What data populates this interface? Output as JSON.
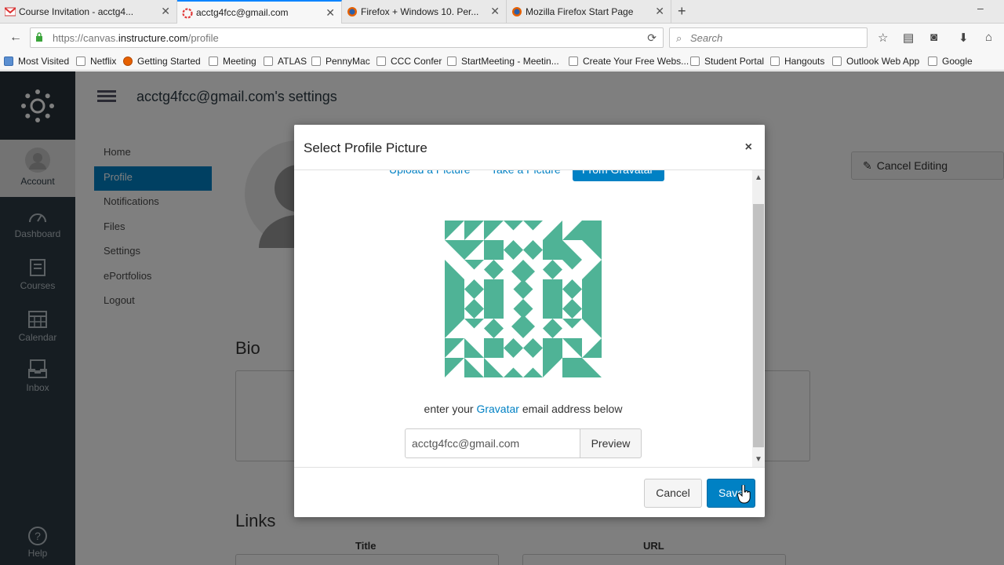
{
  "browser": {
    "tabs": [
      {
        "label": "Course Invitation - acctg4...",
        "icon": "gmail-icon"
      },
      {
        "label": "acctg4fcc@gmail.com",
        "icon": "canvas-icon"
      },
      {
        "label": "Firefox + Windows 10. Per...",
        "icon": "firefox-icon"
      },
      {
        "label": "Mozilla Firefox Start Page",
        "icon": "firefox-icon"
      }
    ],
    "url_prefix": "https://canvas.",
    "url_domain": "instructure.com",
    "url_path": "/profile",
    "search_placeholder": "Search",
    "bookmarks": [
      "Most Visited",
      "Netflix",
      "Getting Started",
      "Meeting",
      "ATLAS",
      "PennyMac",
      "CCC Confer",
      "StartMeeting - Meetin...",
      "Create Your Free Webs...",
      "Student Portal",
      "Hangouts",
      "Outlook Web App",
      "Google"
    ]
  },
  "global_nav": {
    "account": "Account",
    "dashboard": "Dashboard",
    "courses": "Courses",
    "calendar": "Calendar",
    "inbox": "Inbox",
    "help": "Help"
  },
  "header": {
    "title": "acctg4fcc@gmail.com's settings"
  },
  "subnav": {
    "items": [
      "Home",
      "Profile",
      "Notifications",
      "Files",
      "Settings",
      "ePortfolios",
      "Logout"
    ],
    "active": "Profile"
  },
  "profile": {
    "cancel_editing": "Cancel Editing",
    "bio_heading": "Bio",
    "links_heading": "Links",
    "links_title_col": "Title",
    "links_url_col": "URL"
  },
  "modal": {
    "title": "Select Profile Picture",
    "close": "×",
    "tabs": [
      "Upload a Picture",
      "Take a Picture",
      "From Gravatar"
    ],
    "active_tab": "From Gravatar",
    "caption_before": "enter your ",
    "caption_link": "Gravatar",
    "caption_after": " email address below",
    "email_value": "acctg4fcc@gmail.com",
    "preview_label": "Preview",
    "cancel_label": "Cancel",
    "save_label": "Save",
    "accent_color": "#0081c4",
    "gravatar_color": "#4fb396"
  }
}
